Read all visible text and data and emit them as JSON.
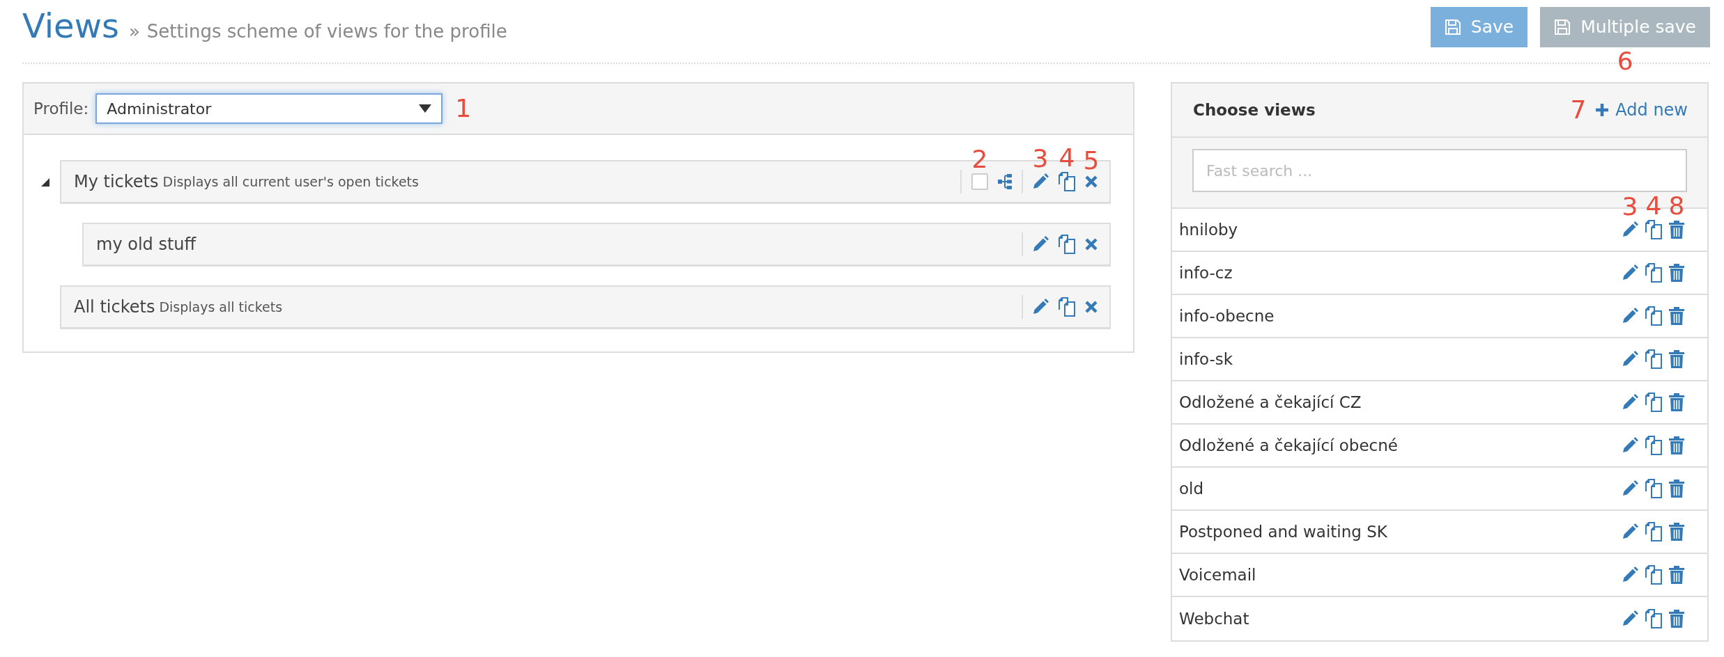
{
  "header": {
    "title": "Views",
    "separator": "»",
    "subtitle": "Settings scheme of views for the profile"
  },
  "buttons": [
    {
      "label": "Save",
      "kind": "save"
    },
    {
      "label": "Multiple save",
      "kind": "multiple",
      "annotation": "6"
    }
  ],
  "profile": {
    "label": "Profile:",
    "value": "Administrator",
    "annotation": "1"
  },
  "tree": [
    {
      "name": "My tickets",
      "description": "Displays all current user's open tickets",
      "expanded": true,
      "checked": false,
      "annotations": {
        "checkbox": "2",
        "edit": "3",
        "copy": "4",
        "remove": "5"
      },
      "children": [
        {
          "name": "my old stuff"
        }
      ]
    },
    {
      "name": "All tickets",
      "description": "Displays all tickets"
    }
  ],
  "views_panel": {
    "title": "Choose views",
    "add": {
      "label": "Add new",
      "annotation": "7"
    },
    "search": {
      "placeholder": "Fast search ..."
    },
    "annotations": {
      "edit": "3",
      "copy": "4",
      "delete": "8"
    },
    "items": [
      "hniloby",
      "info-cz",
      "info-obecne",
      "info-sk",
      "Odložené a čekající CZ",
      "Odložené a čekající obecné",
      "old",
      "Postponed and waiting SK",
      "Voicemail",
      "Webchat"
    ]
  }
}
